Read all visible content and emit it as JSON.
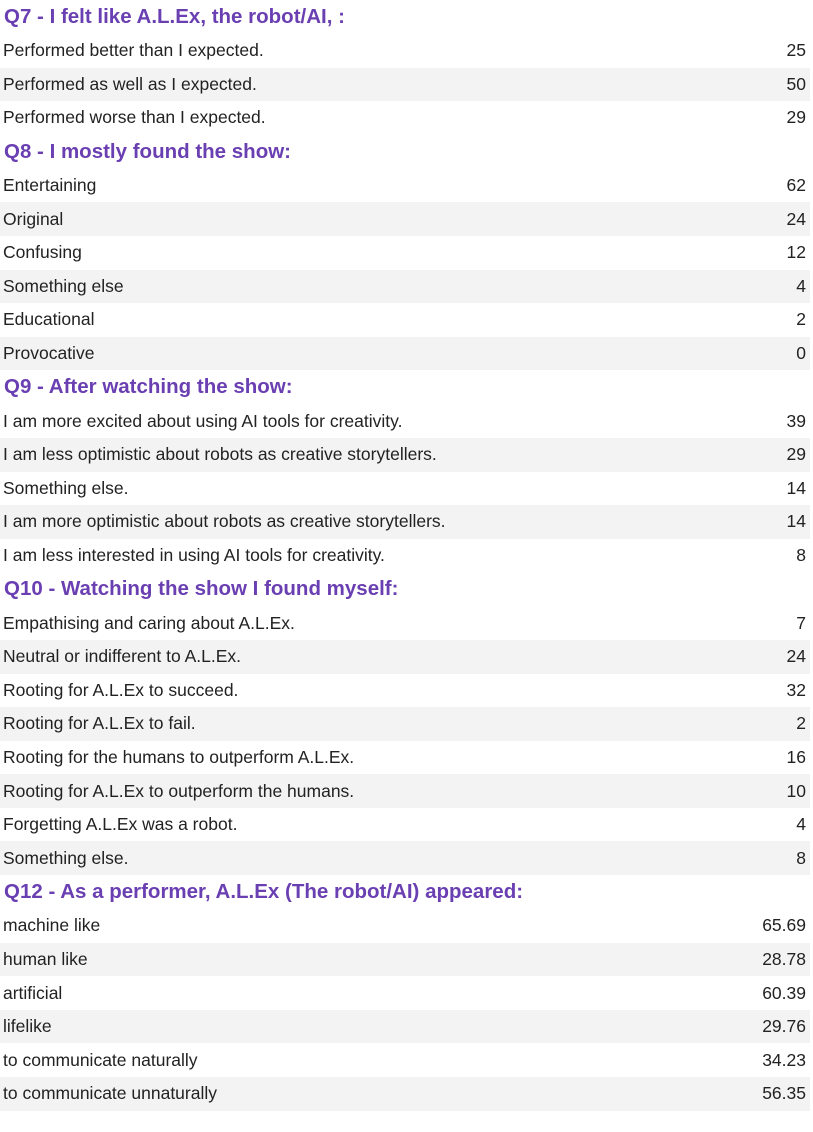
{
  "sections": [
    {
      "title": "Q7 - I felt like A.L.Ex, the robot/AI, :",
      "rows": [
        {
          "label": "Performed better than I expected.",
          "value": "25"
        },
        {
          "label": "Performed as well as I expected.",
          "value": "50"
        },
        {
          "label": "Performed worse than I expected.",
          "value": "29"
        }
      ]
    },
    {
      "title": "Q8 - I mostly found the show:",
      "rows": [
        {
          "label": "Entertaining",
          "value": "62"
        },
        {
          "label": "Original",
          "value": "24"
        },
        {
          "label": "Confusing",
          "value": "12"
        },
        {
          "label": "Something else",
          "value": "4"
        },
        {
          "label": "Educational",
          "value": "2"
        },
        {
          "label": "Provocative",
          "value": "0"
        }
      ]
    },
    {
      "title": "Q9 - After watching the show:",
      "rows": [
        {
          "label": "I am more excited about using AI tools for creativity.",
          "value": "39"
        },
        {
          "label": "I am less optimistic about robots as creative storytellers.",
          "value": "29"
        },
        {
          "label": "Something else.",
          "value": "14"
        },
        {
          "label": "I am more optimistic about robots as creative storytellers.",
          "value": "14"
        },
        {
          "label": "I am less interested in using AI tools for creativity.",
          "value": "8"
        }
      ]
    },
    {
      "title": "Q10 - Watching the show I found myself:",
      "rows": [
        {
          "label": "Empathising and caring about A.L.Ex.",
          "value": "7"
        },
        {
          "label": "Neutral or indifferent to A.L.Ex.",
          "value": "24"
        },
        {
          "label": "Rooting for A.L.Ex to succeed.",
          "value": "32"
        },
        {
          "label": "Rooting for A.L.Ex to fail.",
          "value": "2"
        },
        {
          "label": "Rooting for the humans to outperform A.L.Ex.",
          "value": "16"
        },
        {
          "label": "Rooting for A.L.Ex to outperform the humans.",
          "value": "10"
        },
        {
          "label": "Forgetting A.L.Ex was a robot.",
          "value": "4"
        },
        {
          "label": "Something else.",
          "value": "8"
        }
      ]
    },
    {
      "title": "Q12 - As a performer, A.L.Ex (The robot/AI) appeared:",
      "rows": [
        {
          "label": "machine like",
          "value": "65.69"
        },
        {
          "label": "human like",
          "value": "28.78"
        },
        {
          "label": "artificial",
          "value": "60.39"
        },
        {
          "label": "lifelike",
          "value": "29.76"
        },
        {
          "label": "to communicate naturally",
          "value": "34.23"
        },
        {
          "label": "to communicate unnaturally",
          "value": "56.35"
        }
      ]
    }
  ]
}
